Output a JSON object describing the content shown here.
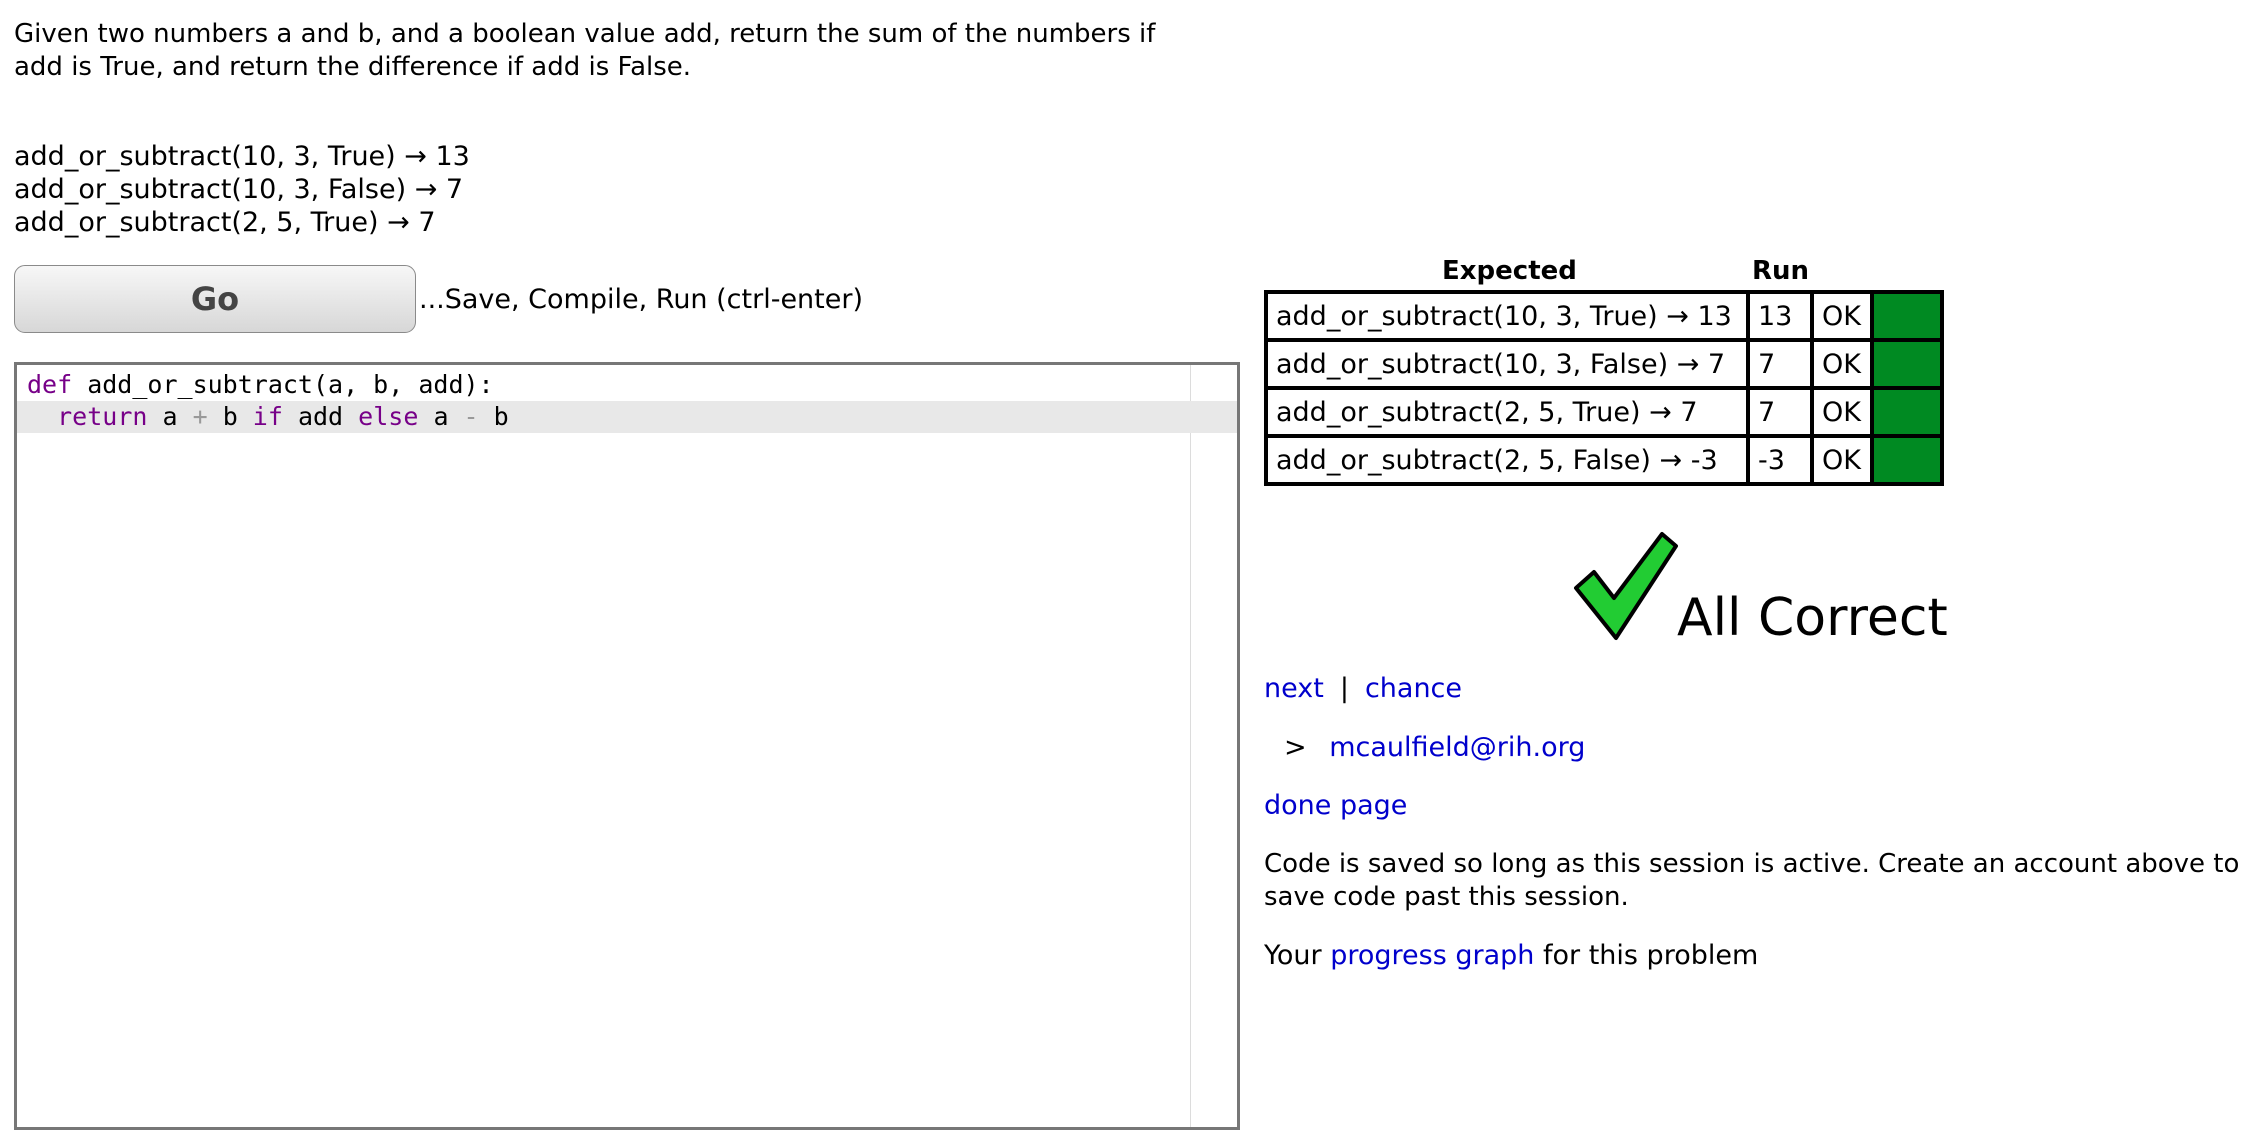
{
  "problem": {
    "description": "Given two numbers a and b, and a boolean value add, return the sum of the numbers if add is True, and return the difference if add is False.",
    "examples": [
      "add_or_subtract(10, 3, True) → 13",
      "add_or_subtract(10, 3, False) → 7",
      "add_or_subtract(2, 5, True) → 7"
    ]
  },
  "toolbar": {
    "go_label": "Go",
    "go_hint": "...Save, Compile, Run (ctrl-enter)"
  },
  "editor": {
    "line1": {
      "kw": "def",
      "rest": " add_or_subtract(a, b, add):"
    },
    "line2": {
      "indent": "  ",
      "kw_return": "return",
      "a1": " a ",
      "plus": "+",
      "b1": " b ",
      "kw_if": "if",
      "add": " add ",
      "kw_else": "else",
      "a2": " a ",
      "minus": "-",
      "b2": " b"
    }
  },
  "results": {
    "header_expected": "Expected",
    "header_run": "Run",
    "status_color": "#008a22",
    "rows": [
      {
        "expected": "add_or_subtract(10, 3, True) → 13",
        "run": "13",
        "status": "OK"
      },
      {
        "expected": "add_or_subtract(10, 3, False) → 7",
        "run": "7",
        "status": "OK"
      },
      {
        "expected": "add_or_subtract(2, 5, True) → 7",
        "run": "7",
        "status": "OK"
      },
      {
        "expected": "add_or_subtract(2, 5, False) → -3",
        "run": "-3",
        "status": "OK"
      }
    ]
  },
  "verdict": {
    "icon": "check-icon",
    "text": "All Correct"
  },
  "nav": {
    "next": "next",
    "separator": "|",
    "chance": "chance"
  },
  "user": {
    "prefix": ">",
    "email": "mcaulfield@rih.org"
  },
  "done_page": "done page",
  "save_note": "Code is saved so long as this session is active. Create an account above to save code past this session.",
  "progress": {
    "before": "Your ",
    "link": "progress graph",
    "after": " for this problem"
  }
}
